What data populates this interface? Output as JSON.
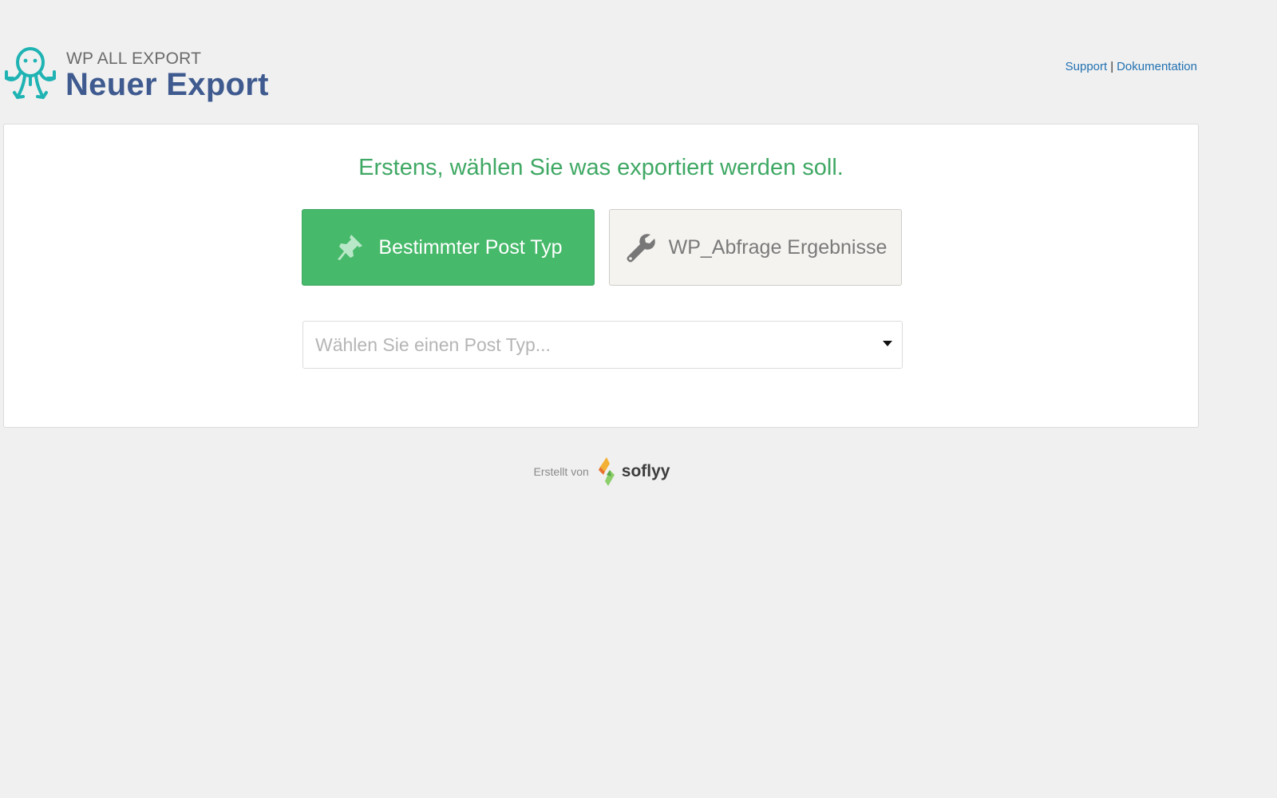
{
  "header": {
    "brand_small": "WP ALL EXPORT",
    "title": "Neuer Export",
    "links": {
      "support": "Support",
      "separator": "|",
      "docs": "Dokumentation"
    }
  },
  "main": {
    "step_title": "Erstens, wählen Sie was exportiert werden soll.",
    "choices": [
      {
        "label": "Bestimmter Post Typ",
        "icon": "pushpin-icon",
        "active": true
      },
      {
        "label": "WP_Abfrage Ergebnisse",
        "icon": "wrench-icon",
        "active": false
      }
    ],
    "post_type_select": {
      "placeholder": "Wählen Sie einen Post Typ...",
      "value": ""
    }
  },
  "footer": {
    "created_by": "Erstellt von",
    "company": "soflyy"
  },
  "colors": {
    "accent_green": "#46b96a",
    "title_green": "#3fa864",
    "brand_blue": "#3e5a8f",
    "logo_teal": "#1fb3b3",
    "link_blue": "#2271b1"
  }
}
